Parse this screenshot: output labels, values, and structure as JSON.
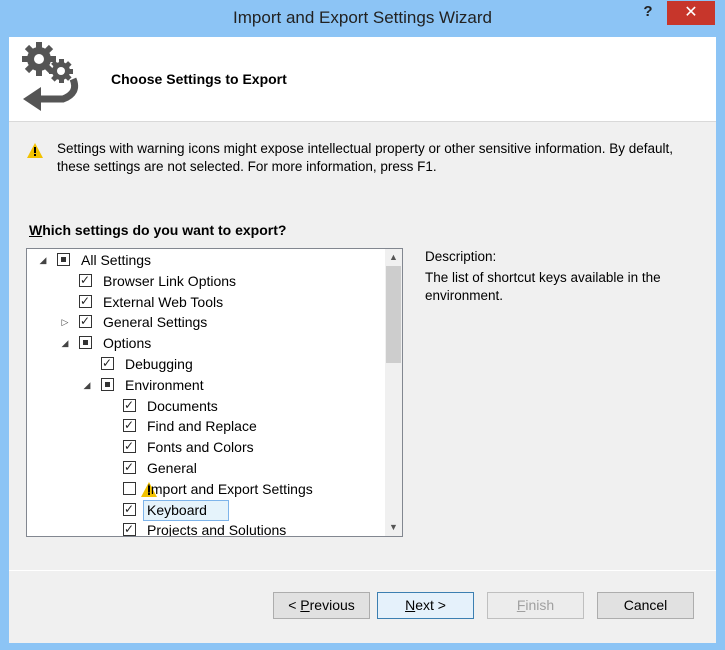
{
  "window": {
    "title": "Import and Export Settings Wizard",
    "help_label": "?",
    "close_label": "✕"
  },
  "header": {
    "title": "Choose Settings to Export"
  },
  "warning": {
    "text": "Settings with warning icons might expose intellectual property or other sensitive information. By default, these settings are not selected. For more information, press F1."
  },
  "question": {
    "prefix_underlined": "W",
    "rest": "hich settings do you want to export?"
  },
  "tree": {
    "items": [
      {
        "label": "All Settings",
        "state": "partial",
        "expander": "expanded"
      },
      {
        "label": "Browser Link Options",
        "state": "checked",
        "expander": ""
      },
      {
        "label": "External Web Tools",
        "state": "checked",
        "expander": ""
      },
      {
        "label": "General Settings",
        "state": "checked",
        "expander": "collapsed"
      },
      {
        "label": "Options",
        "state": "partial",
        "expander": "expanded"
      },
      {
        "label": "Debugging",
        "state": "checked",
        "expander": ""
      },
      {
        "label": "Environment",
        "state": "partial",
        "expander": "expanded"
      },
      {
        "label": "Documents",
        "state": "checked",
        "expander": ""
      },
      {
        "label": "Find and Replace",
        "state": "checked",
        "expander": ""
      },
      {
        "label": "Fonts and Colors",
        "state": "checked",
        "expander": ""
      },
      {
        "label": "General",
        "state": "checked",
        "expander": ""
      },
      {
        "label": "Import and Export Settings",
        "state": "unchecked",
        "expander": "",
        "warning": true
      },
      {
        "label": "Keyboard",
        "state": "checked",
        "expander": "",
        "selected": true
      },
      {
        "label": "Projects and Solutions",
        "state": "checked",
        "expander": ""
      }
    ]
  },
  "description": {
    "label": "Description:",
    "text": "The list of shortcut keys available in the environment."
  },
  "buttons": {
    "previous": "< Previous",
    "next": "Next >",
    "finish": "Finish",
    "cancel": "Cancel"
  },
  "colors": {
    "window_frame": "#8cc4f5",
    "close_button": "#c7362b",
    "selection": "#e5f3fb",
    "warning": "#f2c200"
  }
}
